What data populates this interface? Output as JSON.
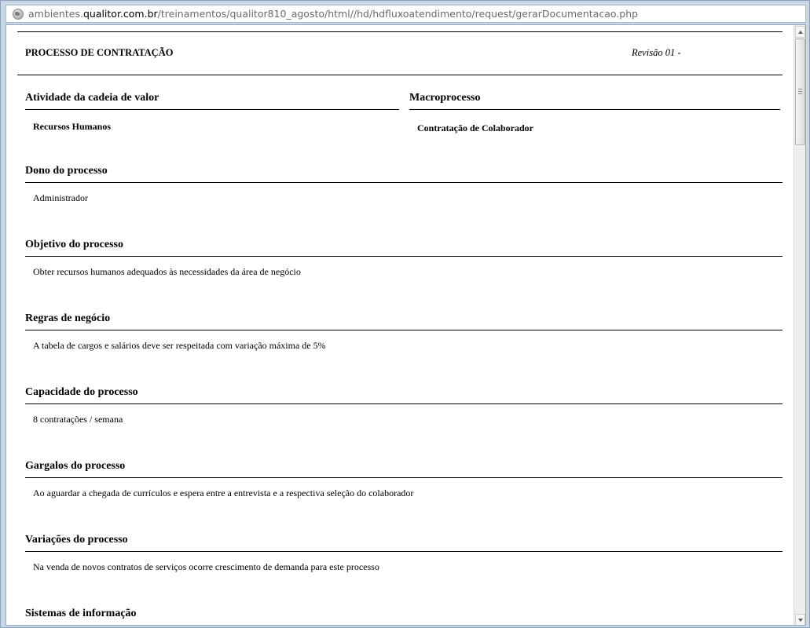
{
  "browser": {
    "url_prefix": "ambientes.",
    "url_domain": "qualitor.com.br",
    "url_path": "/treinamentos/qualitor810_agosto/html//hd/hdfluxoatendimento/request/gerarDocumentacao.php"
  },
  "document": {
    "title": "PROCESSO DE CONTRATAÇÃO",
    "revision": "Revisão 01 -",
    "activity": {
      "label": "Atividade da cadeia de valor",
      "value": "Recursos Humanos"
    },
    "macroprocess": {
      "label": "Macroprocesso",
      "value": "Contratação de Colaborador"
    },
    "sections": [
      {
        "label": "Dono do processo",
        "value": "Administrador"
      },
      {
        "label": "Objetivo do processo",
        "value": "Obter recursos humanos adequados às necessidades da área de negócio"
      },
      {
        "label": "Regras de negócio",
        "value": "A tabela de cargos e salários deve ser respeitada com variação máxima de 5%"
      },
      {
        "label": "Capacidade do processo",
        "value": "8 contratações / semana"
      },
      {
        "label": "Gargalos do processo",
        "value": "Ao aguardar a chegada de currículos e espera entre a entrevista e a respectiva seleção do colaborador"
      },
      {
        "label": "Variações do processo",
        "value": "Na venda de novos contratos de serviços ocorre crescimento de demanda para este processo"
      },
      {
        "label": "Sistemas de informação",
        "value": ""
      }
    ]
  }
}
